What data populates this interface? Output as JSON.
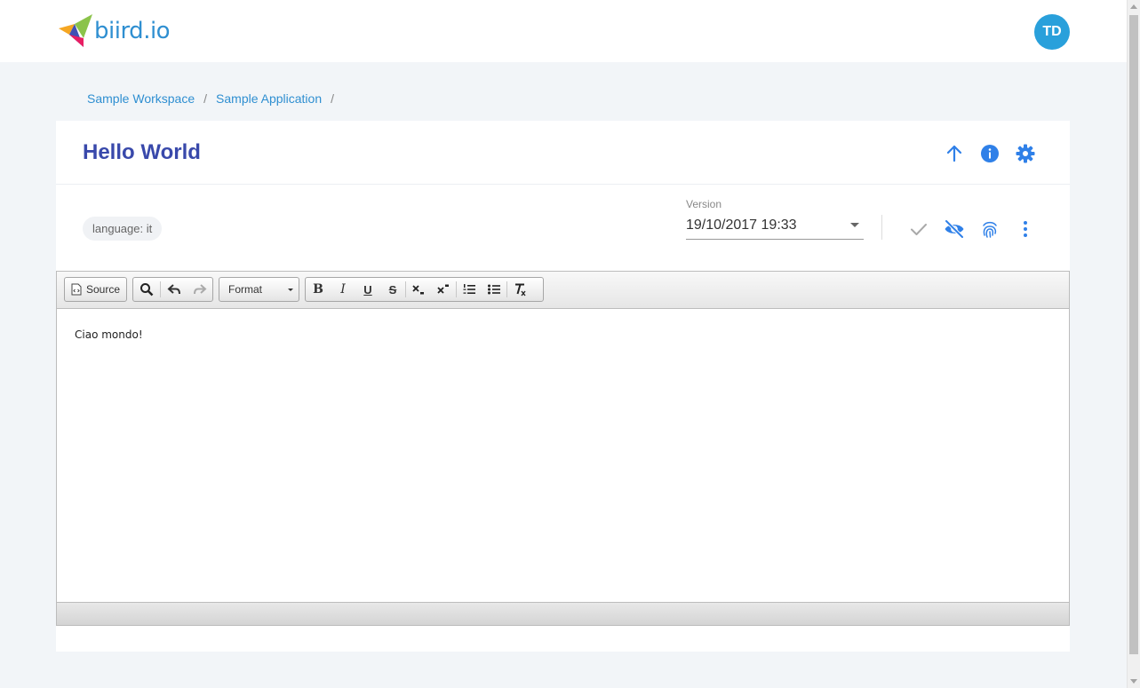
{
  "app": {
    "logo_text": "biird.io",
    "avatar_initials": "TD"
  },
  "breadcrumb": {
    "items": [
      "Sample Workspace",
      "Sample Application"
    ],
    "separator": "/"
  },
  "page": {
    "title": "Hello World"
  },
  "meta": {
    "chip": "language: it",
    "version_label": "Version",
    "version_value": "19/10/2017 19:33"
  },
  "toolbar": {
    "source_label": "Source",
    "format_label": "Format",
    "bold": "B",
    "italic": "I",
    "underline": "U",
    "strike": "S"
  },
  "editor": {
    "content": "Ciao mondo!"
  },
  "colors": {
    "brand": "#2f8fd1",
    "title": "#3949ab",
    "icon_blue": "#2f80e8",
    "avatar": "#29a0db"
  },
  "icons": [
    "arrow-up-icon",
    "info-icon",
    "gear-icon",
    "check-icon",
    "eye-off-icon",
    "fingerprint-icon",
    "more-vert-icon"
  ]
}
